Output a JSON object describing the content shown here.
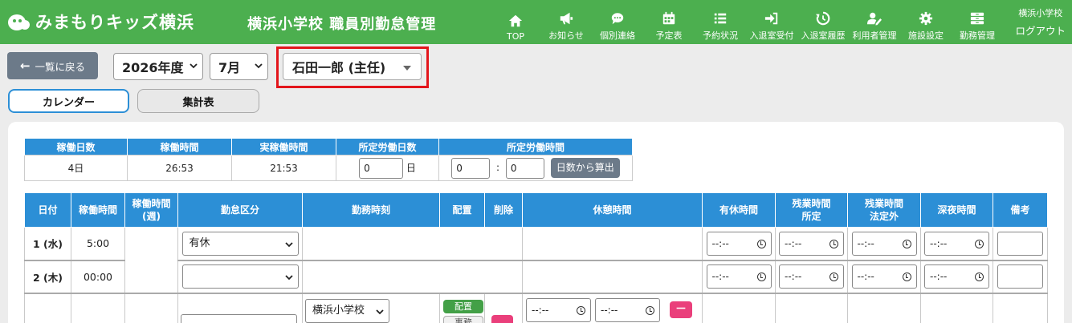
{
  "header": {
    "logo_text": "みまもりキッズ横浜",
    "page_title": "横浜小学校 職員別勤怠管理",
    "nav": [
      {
        "id": "top",
        "label": "TOP",
        "icon": "home-icon"
      },
      {
        "id": "news",
        "label": "お知らせ",
        "icon": "megaphone-icon"
      },
      {
        "id": "contact",
        "label": "個別連絡",
        "icon": "chat-icon"
      },
      {
        "id": "schedule",
        "label": "予定表",
        "icon": "calendar-icon"
      },
      {
        "id": "reservations",
        "label": "予約状況",
        "icon": "list-icon"
      },
      {
        "id": "entry",
        "label": "入退室受付",
        "icon": "sign-in-icon"
      },
      {
        "id": "history",
        "label": "入退室履歴",
        "icon": "history-icon"
      },
      {
        "id": "users",
        "label": "利用者管理",
        "icon": "user-edit-icon"
      },
      {
        "id": "facility",
        "label": "施設設定",
        "icon": "gear-icon"
      },
      {
        "id": "attendance",
        "label": "勤務管理",
        "icon": "drawer-icon"
      }
    ],
    "user_school": "横浜小学校",
    "logout_label": "ログアウト"
  },
  "controls": {
    "back_label": "一覧に戻る",
    "year_value": "2026年度",
    "month_value": "7月",
    "staff_value": "石田一郎 (主任)"
  },
  "tabs": {
    "calendar": "カレンダー",
    "summary": "集計表"
  },
  "summary": {
    "headers": [
      "稼働日数",
      "稼働時間",
      "実稼働時間",
      "所定労働日数",
      "所定労働時間"
    ],
    "work_days": "4日",
    "work_time": "26:53",
    "actual_time": "21:53",
    "scheduled_days_value": "0",
    "day_unit": "日",
    "scheduled_hours_value": "0",
    "scheduled_minutes_value": "0",
    "colon": ":",
    "calc_button": "日数から算出"
  },
  "table": {
    "headers": {
      "date": "日付",
      "work_time": "稼働時間",
      "weekly": "稼働時間\n(週)",
      "category": "勤怠区分",
      "shift": "勤務時刻",
      "assign": "配置",
      "delete": "削除",
      "break": "休憩時間",
      "paid_leave": "有休時間",
      "ot_scheduled": "残業時間\n所定",
      "ot_legal": "残業時間\n法定外",
      "night": "深夜時間",
      "note": "備考"
    },
    "time_placeholder": "--:--",
    "rows": [
      {
        "date": "1 (水)",
        "work_time": "5:00",
        "category": "有休"
      },
      {
        "date": "2 (木)",
        "work_time": "00:00",
        "category": ""
      },
      {
        "date": "",
        "work_time": "",
        "category": "",
        "school": "横浜小学校",
        "assign_label": "配置",
        "assign_sub": "事務",
        "minus": "－"
      }
    ]
  }
}
